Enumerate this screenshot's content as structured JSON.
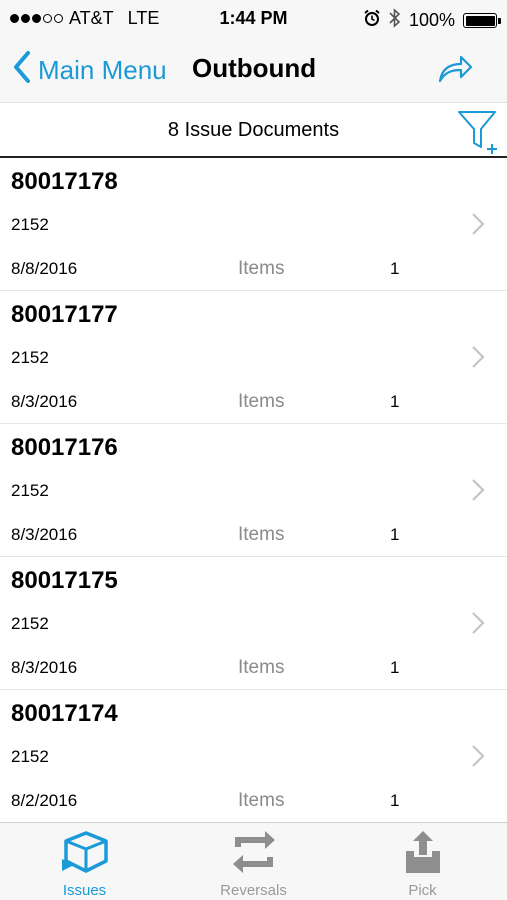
{
  "status_bar": {
    "carrier": "AT&T",
    "network": "LTE",
    "time": "1:44 PM",
    "battery": "100%",
    "signal_filled": 3,
    "signal_total": 5
  },
  "nav": {
    "back_label": "Main Menu",
    "title": "Outbound",
    "share_icon": "share-icon"
  },
  "list_header": {
    "count_label": "8 Issue Documents",
    "filter_icon": "filter-add-icon"
  },
  "documents": [
    {
      "number": "80017178",
      "plant": "2152",
      "date": "8/8/2016",
      "items_label": "Items",
      "items_count": "1"
    },
    {
      "number": "80017177",
      "plant": "2152",
      "date": "8/3/2016",
      "items_label": "Items",
      "items_count": "1"
    },
    {
      "number": "80017176",
      "plant": "2152",
      "date": "8/3/2016",
      "items_label": "Items",
      "items_count": "1"
    },
    {
      "number": "80017175",
      "plant": "2152",
      "date": "8/3/2016",
      "items_label": "Items",
      "items_count": "1"
    },
    {
      "number": "80017174",
      "plant": "2152",
      "date": "8/2/2016",
      "items_label": "Items",
      "items_count": "1"
    }
  ],
  "tabs": [
    {
      "label": "Issues",
      "icon": "issues-box-icon",
      "active": true
    },
    {
      "label": "Reversals",
      "icon": "reversals-icon",
      "active": false
    },
    {
      "label": "Pick",
      "icon": "pick-upload-icon",
      "active": false
    }
  ],
  "colors": {
    "accent": "#1a9ad6",
    "inactive": "#9a9a9a",
    "bar_background": "#f7f7f7"
  }
}
